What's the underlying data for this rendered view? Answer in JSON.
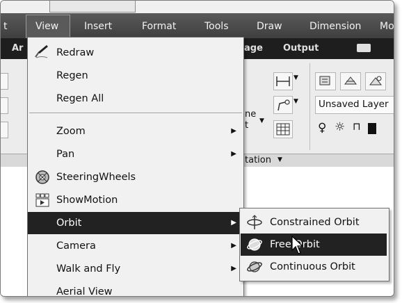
{
  "menubar": {
    "items": [
      "t",
      "View",
      "Insert",
      "Format",
      "Tools",
      "Draw",
      "Dimension",
      "Mo"
    ]
  },
  "ribbon": {
    "tabs": {
      "left": "Ar",
      "manage": "age",
      "output": "Output"
    },
    "layer_combo": "Unsaved Layer",
    "line_fragment_1": "ne",
    "line_fragment_2": "t",
    "annotation_panel_label": "tation"
  },
  "view_menu": {
    "items": [
      {
        "label": "Redraw",
        "icon": "redraw-pencil-icon"
      },
      {
        "label": "Regen"
      },
      {
        "label": "Regen All"
      },
      {
        "label": "Zoom",
        "submenu": true
      },
      {
        "label": "Pan",
        "submenu": true
      },
      {
        "label": "SteeringWheels",
        "icon": "steeringwheels-icon"
      },
      {
        "label": "ShowMotion",
        "icon": "showmotion-icon"
      },
      {
        "label": "Orbit",
        "submenu": true,
        "highlighted": true
      },
      {
        "label": "Camera",
        "submenu": true
      },
      {
        "label": "Walk and Fly",
        "submenu": true
      },
      {
        "label": "Aerial View"
      }
    ]
  },
  "orbit_submenu": {
    "items": [
      {
        "label": "Constrained Orbit",
        "icon": "constrained-orbit-icon"
      },
      {
        "label": "Free Orbit",
        "icon": "free-orbit-icon",
        "highlighted": true
      },
      {
        "label": "Continuous Orbit",
        "icon": "continuous-orbit-icon"
      }
    ]
  },
  "colors": {
    "menubar_bg": "#4a4a4a",
    "highlight_bg": "#222222",
    "menu_bg": "#f1f1f1"
  }
}
